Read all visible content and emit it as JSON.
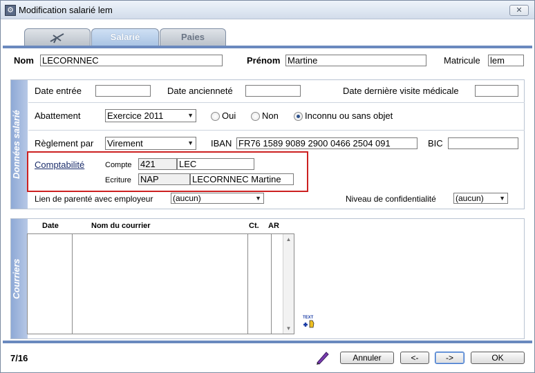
{
  "window": {
    "title": "Modification salarié lem",
    "close_symbol": "✕"
  },
  "tabs": [
    {
      "label": ""
    },
    {
      "label": "Salarié"
    },
    {
      "label": "Paies"
    }
  ],
  "header": {
    "nom_label": "Nom",
    "nom_value": "LECORNNEC",
    "prenom_label": "Prénom",
    "prenom_value": "Martine",
    "matricule_label": "Matricule",
    "matricule_value": "lem"
  },
  "donnees": {
    "section_title": "Données salarié",
    "date_entree_label": "Date entrée",
    "date_entree_value": "",
    "date_anciennete_label": "Date ancienneté",
    "date_anciennete_value": "",
    "date_visite_label": "Date dernière visite médicale",
    "date_visite_value": "",
    "abattement_label": "Abattement",
    "abattement_value": "Exercice 2011",
    "radio_oui": "Oui",
    "radio_non": "Non",
    "radio_inconnu": "Inconnu ou sans objet",
    "reglement_label": "Règlement par",
    "reglement_value": "Virement",
    "iban_label": "IBAN",
    "iban_value": "FR76 1589 9089 2900 0466 2504 091",
    "bic_label": "BIC",
    "bic_value": "",
    "comptabilite_label": "Comptabilité",
    "compte_label": "Compte",
    "compte_code": "421",
    "compte_value": "LEC",
    "ecriture_label": "Ecriture",
    "ecriture_code": "NAP",
    "ecriture_value": "LECORNNEC Martine",
    "lien_label": "Lien de parenté avec employeur",
    "lien_value": "(aucun)",
    "niveau_label": "Niveau de confidentialité",
    "niveau_value": "(aucun)"
  },
  "courriers": {
    "section_title": "Courriers",
    "columns": [
      "Date",
      "Nom du courrier",
      "Ct.",
      "AR"
    ],
    "rows": []
  },
  "footer": {
    "record_position": "7/16",
    "annuler": "Annuler",
    "prev": "<-",
    "next": "->",
    "ok": "OK"
  },
  "icons": {
    "text_icon_label": "TEXT"
  }
}
